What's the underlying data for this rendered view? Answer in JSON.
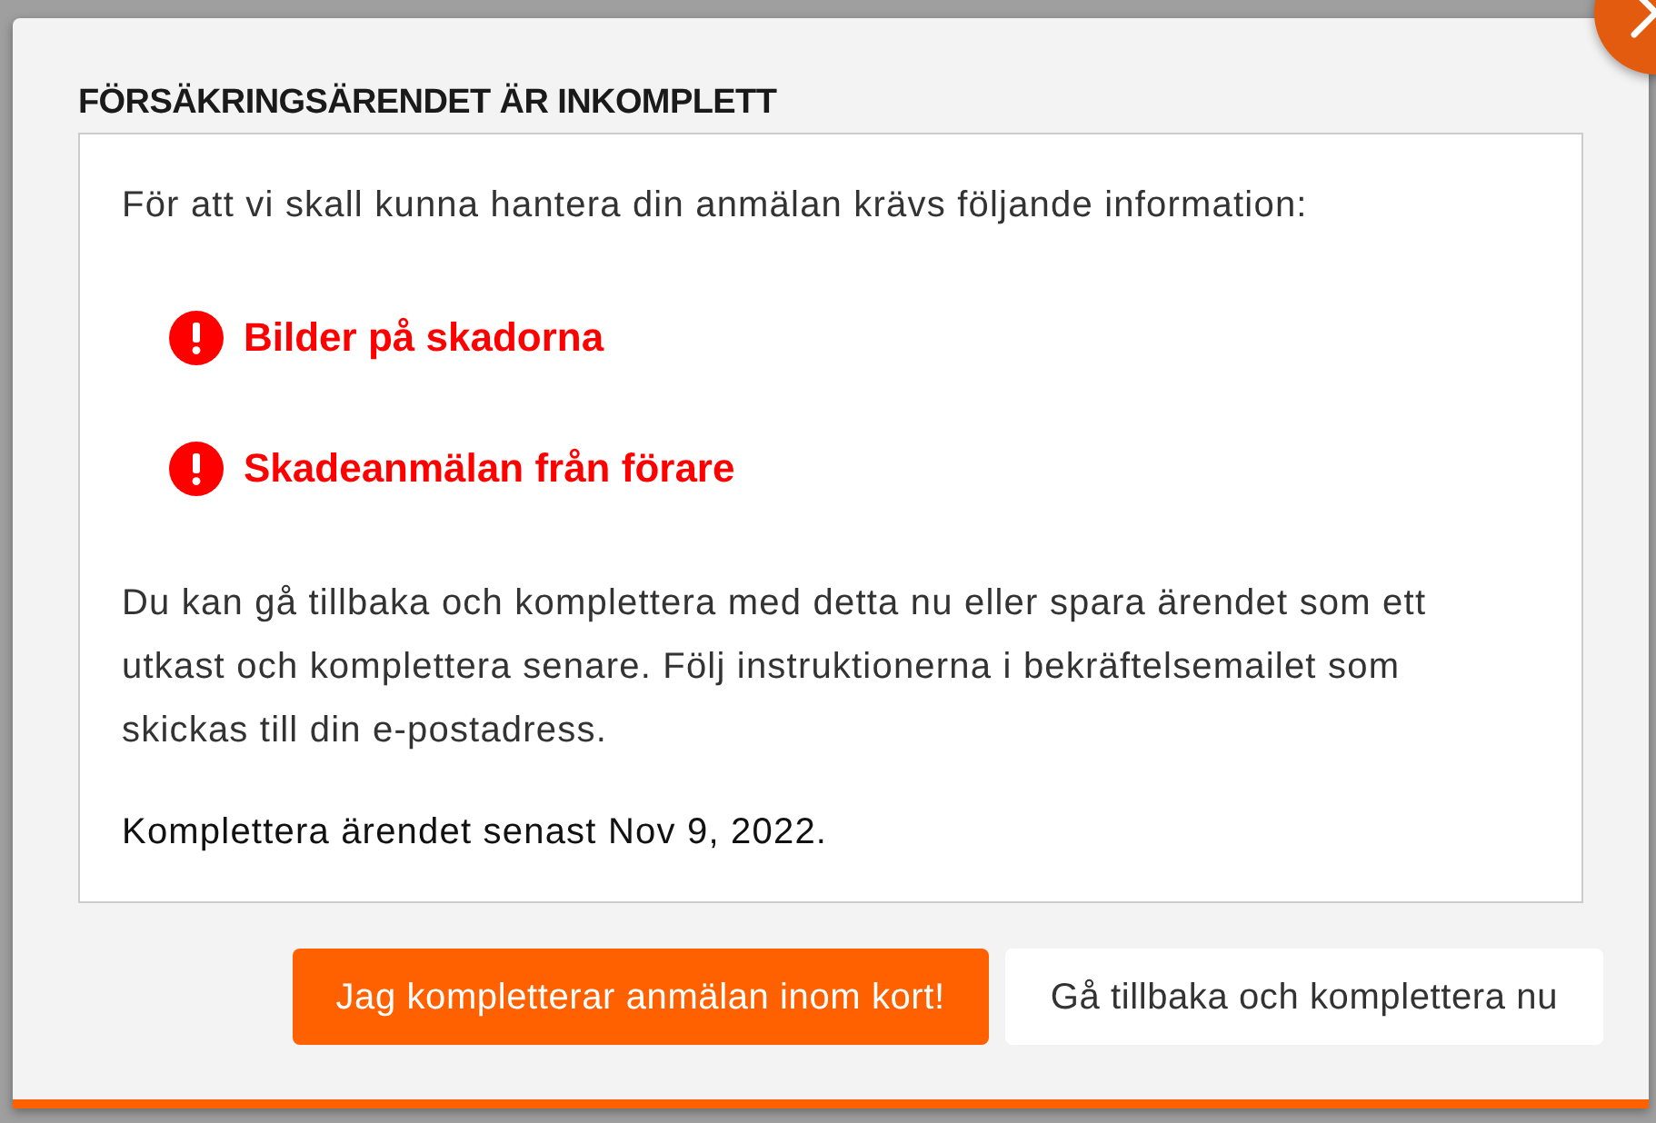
{
  "dialog": {
    "title": "FÖRSÄKRINGSÄRENDET ÄR INKOMPLETT",
    "intro": "För att vi skall kunna hantera din anmälan krävs följande information:",
    "missing_items": [
      {
        "label": "Bilder på skadorna",
        "kind": "error"
      },
      {
        "label": "Skadeanmälan från förare",
        "kind": "error"
      }
    ],
    "instructions": "Du kan gå tillbaka och komplettera med detta nu eller spara ärendet som ett utkast och komplettera senare. Följ instruktionerna i bekräftelsemailet som skickas till din e-postadress.",
    "deadline": "Komplettera ärendet senast Nov 9, 2022.",
    "buttons": [
      {
        "label": "Jag kompletterar anmälan inom kort!",
        "kind": "primary"
      },
      {
        "label": "Gå tillbaka och komplettera nu",
        "kind": "secondary"
      }
    ]
  }
}
